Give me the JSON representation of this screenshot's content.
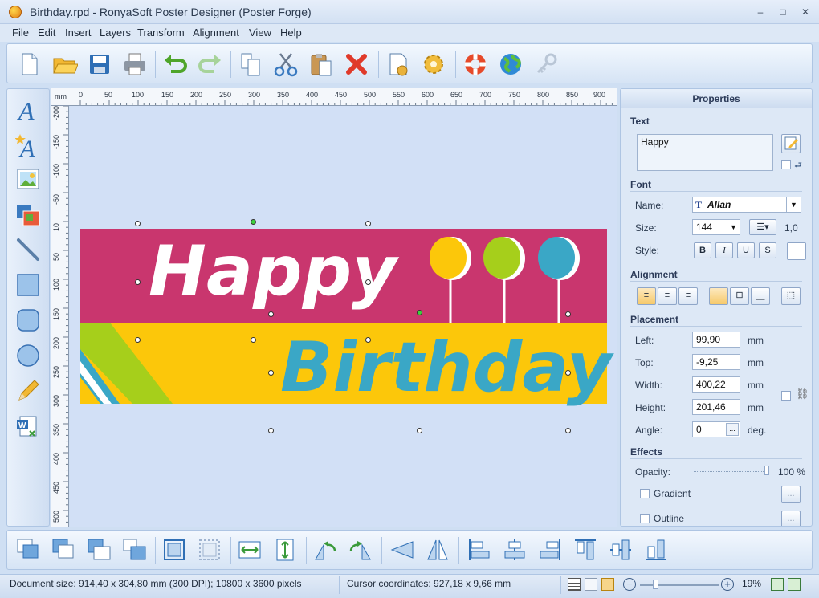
{
  "window": {
    "title": "Birthday.rpd - RonyaSoft Poster Designer (Poster Forge)",
    "min": "–",
    "max": "□",
    "close": "✕"
  },
  "menu": [
    "File",
    "Edit",
    "Insert",
    "Layers",
    "Transform",
    "Alignment",
    "View",
    "Help"
  ],
  "toolbar": {
    "icons": [
      "new-document-icon",
      "open-folder-icon",
      "save-icon",
      "print-icon",
      "undo-icon",
      "redo-icon",
      "copy-icon",
      "cut-icon",
      "paste-icon",
      "delete-icon",
      "document-settings-icon",
      "settings-gear-icon",
      "help-lifebuoy-icon",
      "web-globe-icon",
      "key-register-icon"
    ]
  },
  "lefttools": {
    "icons": [
      "text-icon",
      "curved-text-icon",
      "image-icon",
      "clipart-icon",
      "line-icon",
      "rectangle-icon",
      "rounded-rectangle-icon",
      "ellipse-icon",
      "pencil-icon",
      "word-document-icon"
    ]
  },
  "ruler": {
    "unit": "mm",
    "top": [
      "0",
      "50",
      "100",
      "150",
      "200",
      "250",
      "300",
      "350",
      "400",
      "450",
      "500",
      "550",
      "600",
      "650",
      "700",
      "750",
      "800",
      "850",
      "900"
    ],
    "left": [
      "-200",
      "-150",
      "-100",
      "-50",
      "10",
      "50",
      "100",
      "150",
      "200",
      "250",
      "300",
      "350",
      "400",
      "450",
      "500"
    ]
  },
  "poster": {
    "word1": "Happy",
    "word2": "Birthday",
    "colors": {
      "top": "#c9366e",
      "bottom": "#fcc70a",
      "text2": "#3aa7c6",
      "balloon1": "#fcc70a",
      "balloon2": "#a6cf1b",
      "balloon3": "#3aa7c6"
    }
  },
  "properties": {
    "title": "Properties",
    "text": {
      "heading": "Text",
      "value": "Happy"
    },
    "font": {
      "heading": "Font",
      "name_label": "Name:",
      "name": "Allan",
      "size_label": "Size:",
      "size": "144",
      "line_spacing": "1,0",
      "style_label": "Style:",
      "styles": [
        "B",
        "I",
        "U",
        "S"
      ]
    },
    "alignment": {
      "heading": "Alignment"
    },
    "placement": {
      "heading": "Placement",
      "left_label": "Left:",
      "left": "99,90",
      "left_unit": "mm",
      "top_label": "Top:",
      "top": "-9,25",
      "top_unit": "mm",
      "width_label": "Width:",
      "width": "400,22",
      "width_unit": "mm",
      "height_label": "Height:",
      "height": "201,46",
      "height_unit": "mm",
      "angle_label": "Angle:",
      "angle": "0",
      "angle_unit": "deg."
    },
    "effects": {
      "heading": "Effects",
      "opacity_label": "Opacity:",
      "opacity": "100 %",
      "opacity_level": 1.0,
      "gradient": "Gradient",
      "outline": "Outline",
      "ellipsis": "..."
    }
  },
  "bottomtools": {
    "icons": [
      "bring-to-front-icon",
      "send-to-back-icon",
      "bring-forward-icon",
      "send-backward-icon",
      "group-icon",
      "ungroup-icon",
      "fit-width-icon",
      "fit-height-icon",
      "rotate-left-icon",
      "rotate-right-icon",
      "flip-horizontal-icon",
      "flip-vertical-icon",
      "align-left-icon",
      "align-center-icon",
      "align-right-icon",
      "align-top-icon",
      "align-middle-icon",
      "align-bottom-icon"
    ]
  },
  "status": {
    "doc": "Document size: 914,40 x 304,80 mm (300 DPI); 10800 x 3600 pixels",
    "cursor": "Cursor coordinates: 927,18 x 9,66 mm",
    "zoom": "19%"
  }
}
